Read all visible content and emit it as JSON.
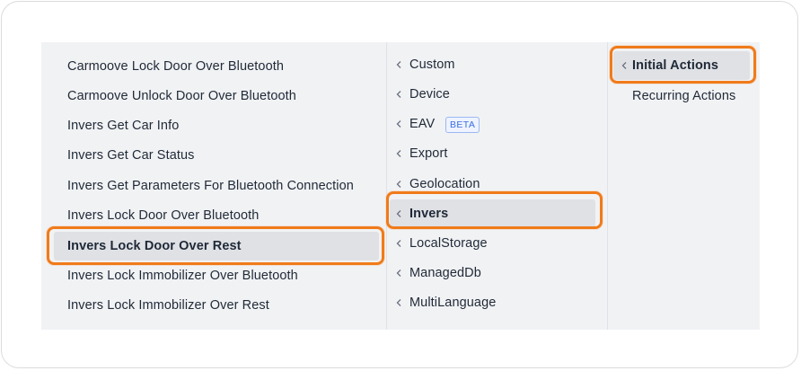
{
  "columns": {
    "actions": [
      {
        "label": "Carmoove Lock Door Over Bluetooth",
        "selected": false
      },
      {
        "label": "Carmoove Unlock Door Over Bluetooth",
        "selected": false
      },
      {
        "label": "Invers Get Car Info",
        "selected": false
      },
      {
        "label": "Invers Get Car Status",
        "selected": false
      },
      {
        "label": "Invers Get Parameters For Bluetooth Connection",
        "selected": false
      },
      {
        "label": "Invers Lock Door Over Bluetooth",
        "selected": false
      },
      {
        "label": "Invers Lock Door Over Rest",
        "selected": true
      },
      {
        "label": "Invers Lock Immobilizer Over Bluetooth",
        "selected": false
      },
      {
        "label": "Invers Lock Immobilizer Over Rest",
        "selected": false
      }
    ],
    "categories": [
      {
        "label": "Custom",
        "selected": false
      },
      {
        "label": "Device",
        "selected": false
      },
      {
        "label": "EAV",
        "badge": "BETA",
        "selected": false
      },
      {
        "label": "Export",
        "selected": false
      },
      {
        "label": "Geolocation",
        "selected": false
      },
      {
        "label": "Invers",
        "selected": true
      },
      {
        "label": "LocalStorage",
        "selected": false
      },
      {
        "label": "ManagedDb",
        "selected": false
      },
      {
        "label": "MultiLanguage",
        "selected": false
      }
    ],
    "action_types": [
      {
        "label": "Initial Actions",
        "selected": true
      },
      {
        "label": "Recurring Actions",
        "selected": false
      }
    ]
  },
  "colors": {
    "highlight": "#f07b1a",
    "selected_bg": "#e0e1e5",
    "panel_bg": "#f1f2f4",
    "badge": "#3b6fe0"
  },
  "icons": {
    "category_expander": "chevron-left-icon"
  }
}
